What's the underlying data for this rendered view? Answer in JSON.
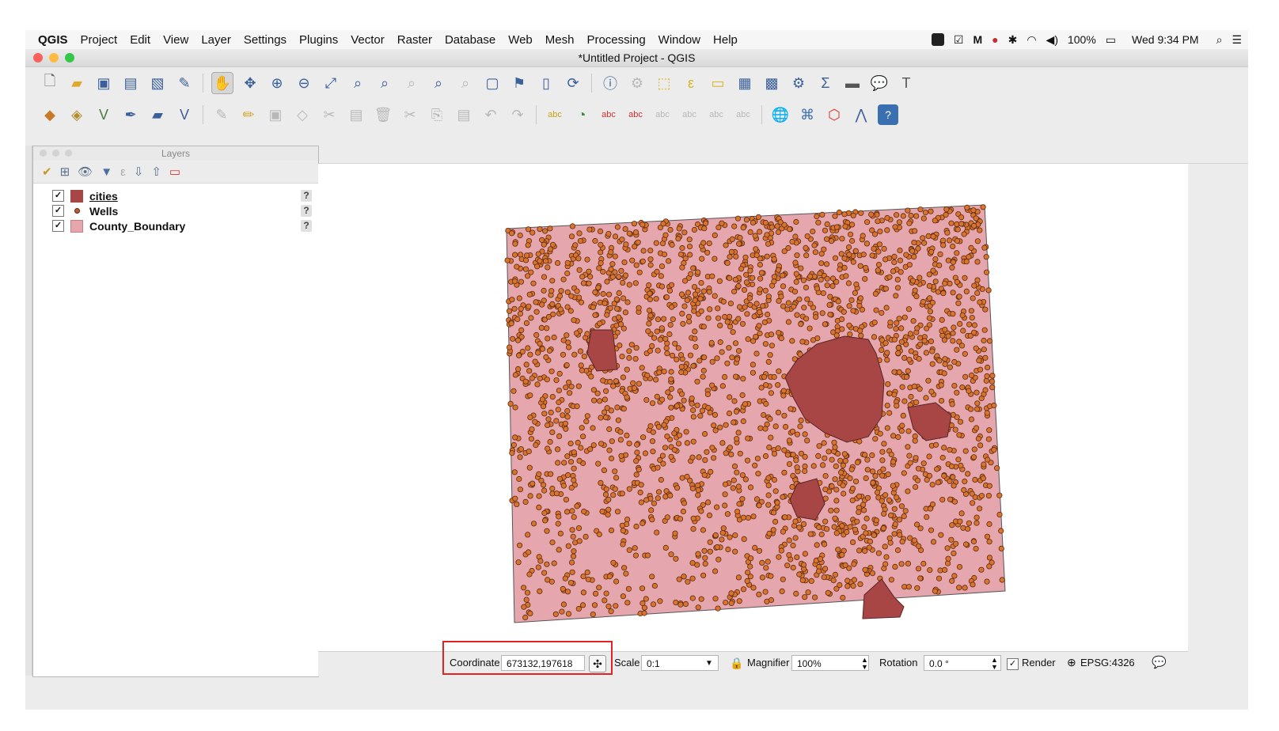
{
  "menubar": {
    "app_name": "QGIS",
    "items": [
      "Project",
      "Edit",
      "View",
      "Layer",
      "Settings",
      "Plugins",
      "Vector",
      "Raster",
      "Database",
      "Web",
      "Mesh",
      "Processing",
      "Window",
      "Help"
    ],
    "battery": "100%",
    "clock": "Wed 9:34 PM"
  },
  "window": {
    "title": "*Untitled Project - QGIS"
  },
  "layers_panel": {
    "title": "Layers",
    "layers": [
      {
        "name": "cities",
        "checked": true,
        "color": "#a84646",
        "symbol": "polygon"
      },
      {
        "name": "Wells",
        "checked": true,
        "color": "#c0593a",
        "symbol": "point"
      },
      {
        "name": "County_Boundary",
        "checked": true,
        "color": "#e6a6ad",
        "symbol": "polygon"
      }
    ]
  },
  "map": {
    "boundary_color": "#e6a6ad",
    "city_color": "#a84646",
    "well_color": "#d9742f",
    "well_outline": "#5a2a10"
  },
  "statusbar": {
    "coordinate_label": "Coordinate",
    "coordinate_value": "673132,197618",
    "scale_label": "Scale",
    "scale_value": "0:1",
    "magnifier_label": "Magnifier",
    "magnifier_value": "100%",
    "rotation_label": "Rotation",
    "rotation_value": "0.0 °",
    "render_label": "Render",
    "render_checked": true,
    "crs": "EPSG:4326"
  },
  "highlight_color": "#e02424"
}
